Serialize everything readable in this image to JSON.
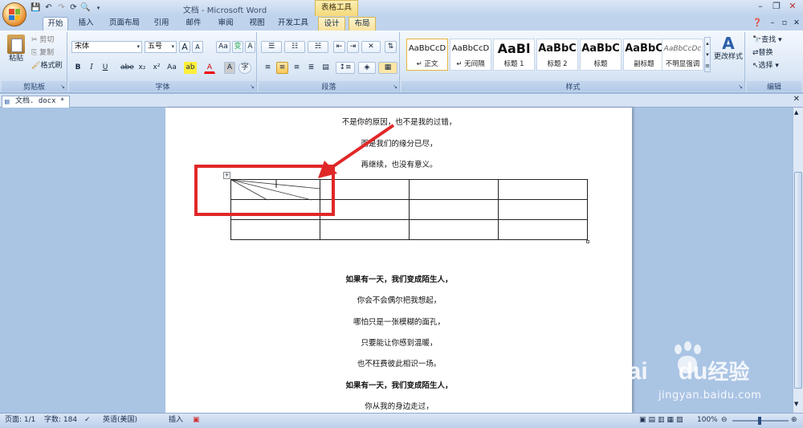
{
  "title_bar": {
    "title": "文档 - Microsoft Word",
    "context_tab_group": "表格工具"
  },
  "tabs": [
    {
      "label": "开始",
      "active": true
    },
    {
      "label": "插入"
    },
    {
      "label": "页面布局"
    },
    {
      "label": "引用"
    },
    {
      "label": "邮件"
    },
    {
      "label": "审阅"
    },
    {
      "label": "视图"
    },
    {
      "label": "开发工具"
    },
    {
      "label": "设计",
      "contextual": true
    },
    {
      "label": "布局",
      "contextual": true
    }
  ],
  "clipboard": {
    "paste": "粘贴",
    "cut": "剪切",
    "copy": "复制",
    "format_painter": "格式刷",
    "group_label": "剪贴板"
  },
  "font": {
    "name": "宋体",
    "size": "五号",
    "bold": "B",
    "italic": "I",
    "underline": "U",
    "strike": "abe",
    "subscript": "x₂",
    "superscript": "x²",
    "change_case": "Aa",
    "highlight": "ab",
    "font_color": "A",
    "char_shading": "A",
    "enclose": "字",
    "grow": "A",
    "shrink": "A",
    "clear_format": "Aa",
    "phonetic": "变",
    "border": "A",
    "group_label": "字体"
  },
  "paragraph": {
    "group_label": "段落"
  },
  "styles": {
    "items": [
      {
        "sample": "AaBbCcD",
        "name": "↵ 正文"
      },
      {
        "sample": "AaBbCcD",
        "name": "↵ 无间隔"
      },
      {
        "sample": "AaBl",
        "name": "标题 1"
      },
      {
        "sample": "AaBbC",
        "name": "标题 2"
      },
      {
        "sample": "AaBbC",
        "name": "标题"
      },
      {
        "sample": "AaBbC",
        "name": "副标题"
      },
      {
        "sample": "AaBbCcDc",
        "name": "不明显强调"
      }
    ],
    "change_styles": "更改样式",
    "group_label": "样式"
  },
  "editing": {
    "find": "查找",
    "replace": "替换",
    "select": "选择",
    "group_label": "编辑"
  },
  "document_tab": {
    "label": "文档. docx *"
  },
  "document": {
    "lines_top": [
      "不是你的原因，也不是我的过错，",
      "而是我们的缘分已尽，",
      "再继续，也没有意义。"
    ],
    "lines_bottom": [
      {
        "text": "如果有一天，我们变成陌生人，",
        "bold": true
      },
      {
        "text": "你会不会偶尔把我想起，"
      },
      {
        "text": "哪怕只是一张模糊的面孔，"
      },
      {
        "text": "只要能让你感到温暖，"
      },
      {
        "text": "也不枉费彼此相识一场。"
      },
      {
        "text": "如果有一天，我们变成陌生人，",
        "bold": true
      },
      {
        "text": "你从我的身边走过，"
      }
    ],
    "table": {
      "rows": 3,
      "cols": 4
    }
  },
  "status_bar": {
    "page": "页面: 1/1",
    "words": "字数: 184",
    "language": "英语(美国)",
    "mode": "插入",
    "zoom": "100%"
  },
  "watermark": {
    "brand": "Bai",
    "brand2": "du",
    "brand_cn": "经验",
    "url": "jingyan.baidu.com"
  },
  "colors": {
    "accent": "#e02828",
    "ribbon": "#dce8f6",
    "frame": "#aac4e4"
  }
}
